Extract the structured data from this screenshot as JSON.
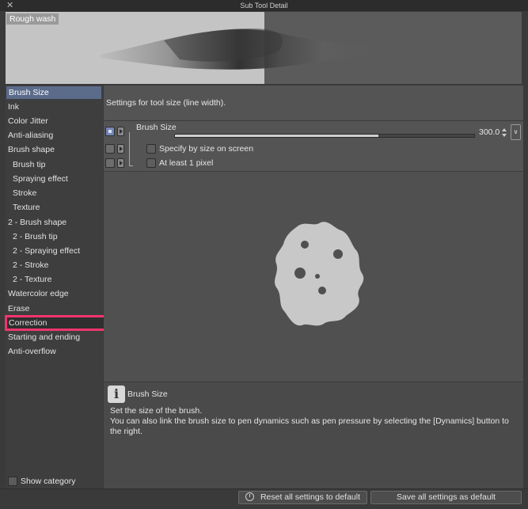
{
  "window": {
    "title": "Sub Tool Detail",
    "close_glyph": "✕"
  },
  "preview": {
    "label": "Rough wash"
  },
  "sidebar": {
    "items": [
      {
        "label": "Brush Size",
        "selected": true
      },
      {
        "label": "Ink"
      },
      {
        "label": "Color Jitter"
      },
      {
        "label": "Anti-aliasing"
      },
      {
        "label": "Brush shape"
      },
      {
        "label": "Brush tip"
      },
      {
        "label": "Spraying effect"
      },
      {
        "label": "Stroke"
      },
      {
        "label": "Texture"
      },
      {
        "label": "2 - Brush shape"
      },
      {
        "label": "2 - Brush tip"
      },
      {
        "label": "2 - Spraying effect"
      },
      {
        "label": "2 - Stroke"
      },
      {
        "label": "2 - Texture"
      },
      {
        "label": "Watercolor edge"
      },
      {
        "label": "Erase"
      },
      {
        "label": "Correction",
        "highlighted": true
      },
      {
        "label": "Starting and ending"
      },
      {
        "label": "Anti-overflow"
      }
    ],
    "show_category": "Show category"
  },
  "main": {
    "description": "Settings for tool size (line width).",
    "brush_size": {
      "label": "Brush Size",
      "value": "300.0",
      "fraction": 0.68
    },
    "options": [
      {
        "label": "Specify by size on screen",
        "checked": false
      },
      {
        "label": "At least 1 pixel",
        "checked": false
      }
    ]
  },
  "info": {
    "icon": "i",
    "title": "Brush Size",
    "lines": [
      "Set the size of the brush.",
      "You can also link the brush size to pen dynamics such as pen pressure by selecting the [Dynamics] button to",
      "the right."
    ]
  },
  "footer": {
    "reset_label": "Reset all settings to default",
    "save_label": "Save all settings as default"
  },
  "colors": {
    "selection": "#5b6b8a",
    "highlight": "#f0356e"
  }
}
